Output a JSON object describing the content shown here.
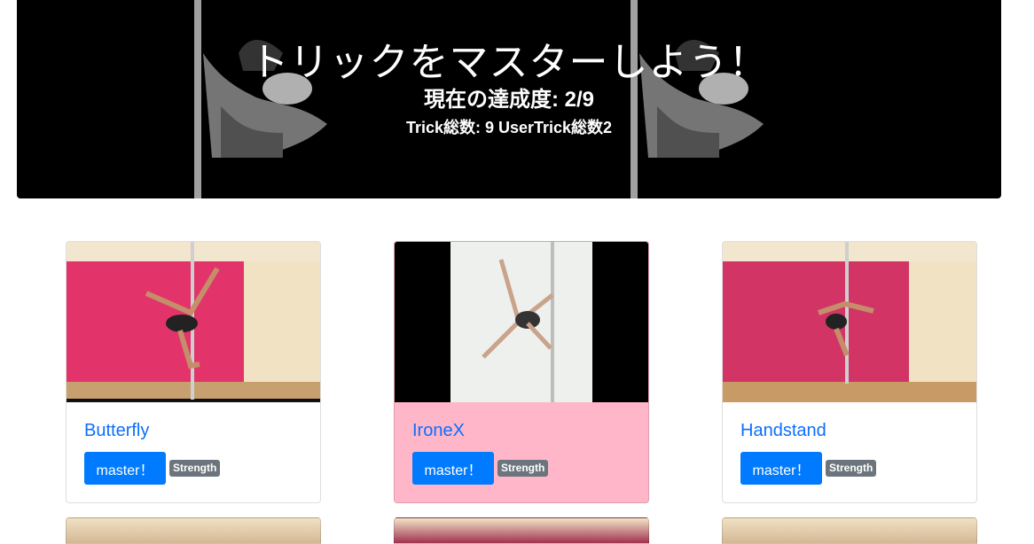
{
  "hero": {
    "title": "トリックをマスターしよう！",
    "progress": "現在の達成度: 2/9",
    "stats": "Trick総数: 9 UserTrick総数2"
  },
  "cards": [
    {
      "title": "Butterfly",
      "button": "master！",
      "badge": "Strength",
      "highlighted": false
    },
    {
      "title": "IroneX",
      "button": "master！",
      "badge": "Strength",
      "highlighted": true
    },
    {
      "title": "Handstand",
      "button": "master！",
      "badge": "Strength",
      "highlighted": false
    }
  ],
  "colors": {
    "link": "#0d6efd",
    "primary_button": "#007bff",
    "badge": "#6c757d",
    "highlight_card": "#ffb6c8"
  }
}
